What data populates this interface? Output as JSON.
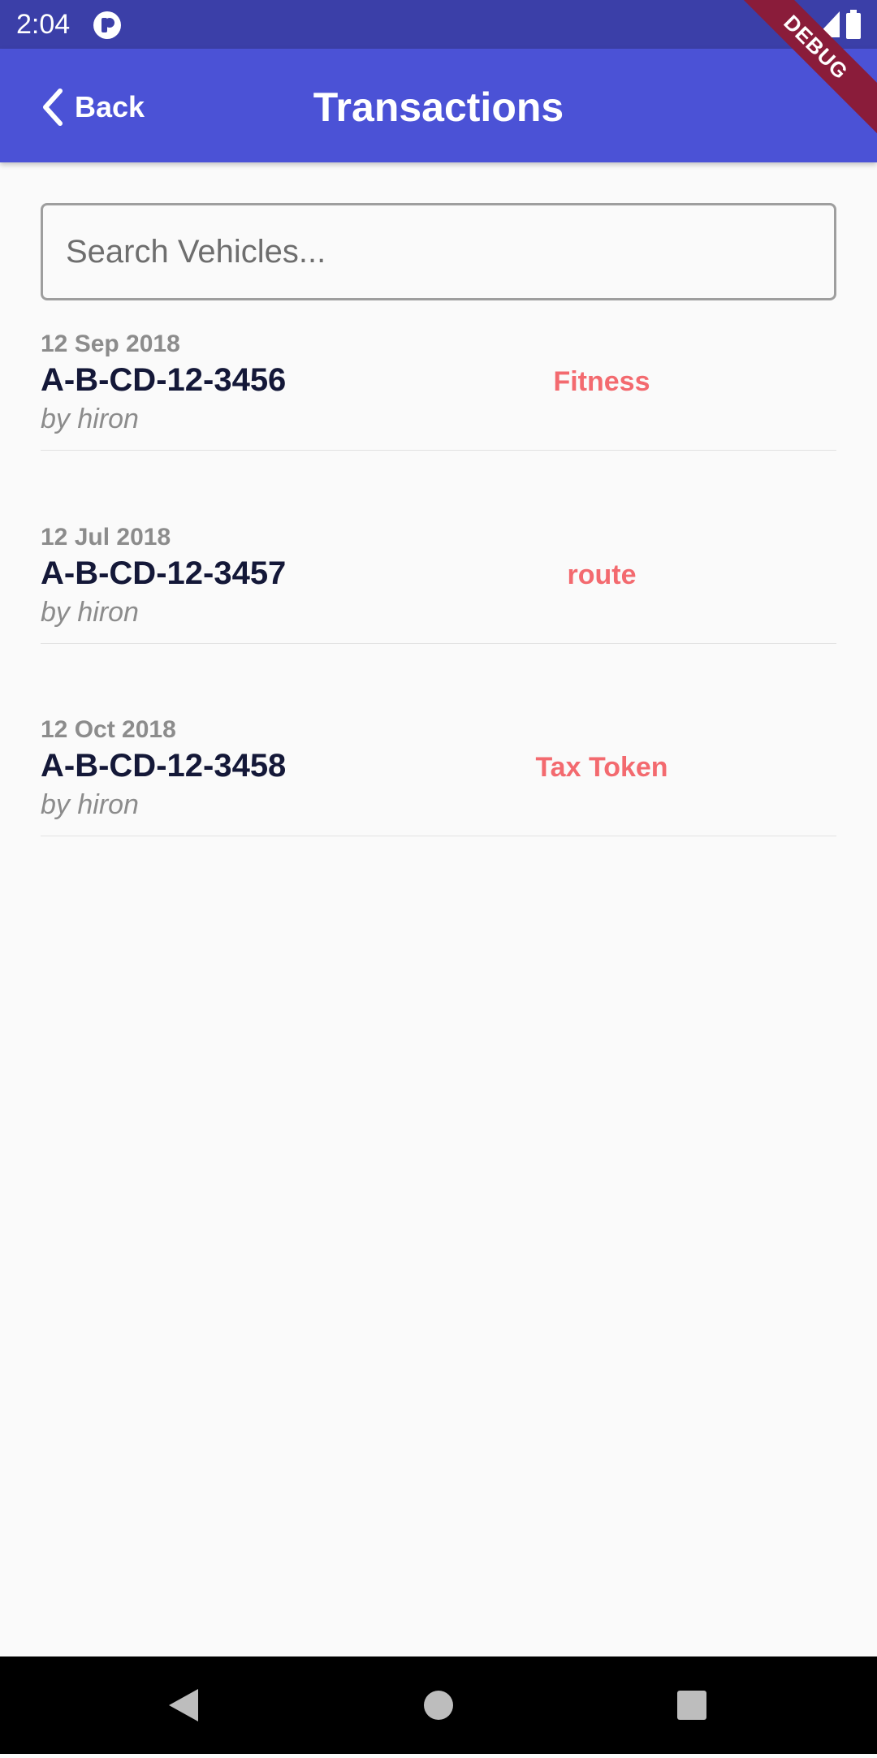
{
  "status_bar": {
    "time": "2:04",
    "icons": [
      "app-notification-icon",
      "wifi-icon",
      "signal-icon",
      "battery-icon"
    ]
  },
  "app_bar": {
    "back_label": "Back",
    "title": "Transactions",
    "color": "#4b52d6"
  },
  "debug_banner": "DEBUG",
  "search": {
    "placeholder": "Search Vehicles...",
    "value": ""
  },
  "transactions": [
    {
      "date": "12 Sep 2018",
      "plate": "A-B-CD-12-3456",
      "author": "by hiron",
      "type": "Fitness"
    },
    {
      "date": "12 Jul 2018",
      "plate": "A-B-CD-12-3457",
      "author": "by hiron",
      "type": "route"
    },
    {
      "date": "12 Oct 2018",
      "plate": "A-B-CD-12-3458",
      "author": "by hiron",
      "type": "Tax Token"
    }
  ],
  "colors": {
    "status_bar": "#3b3fa8",
    "type_label": "#f36a6f",
    "plate_text": "#141838"
  },
  "nav_bar": {
    "buttons": [
      "back-icon",
      "home-icon",
      "recents-icon"
    ]
  }
}
